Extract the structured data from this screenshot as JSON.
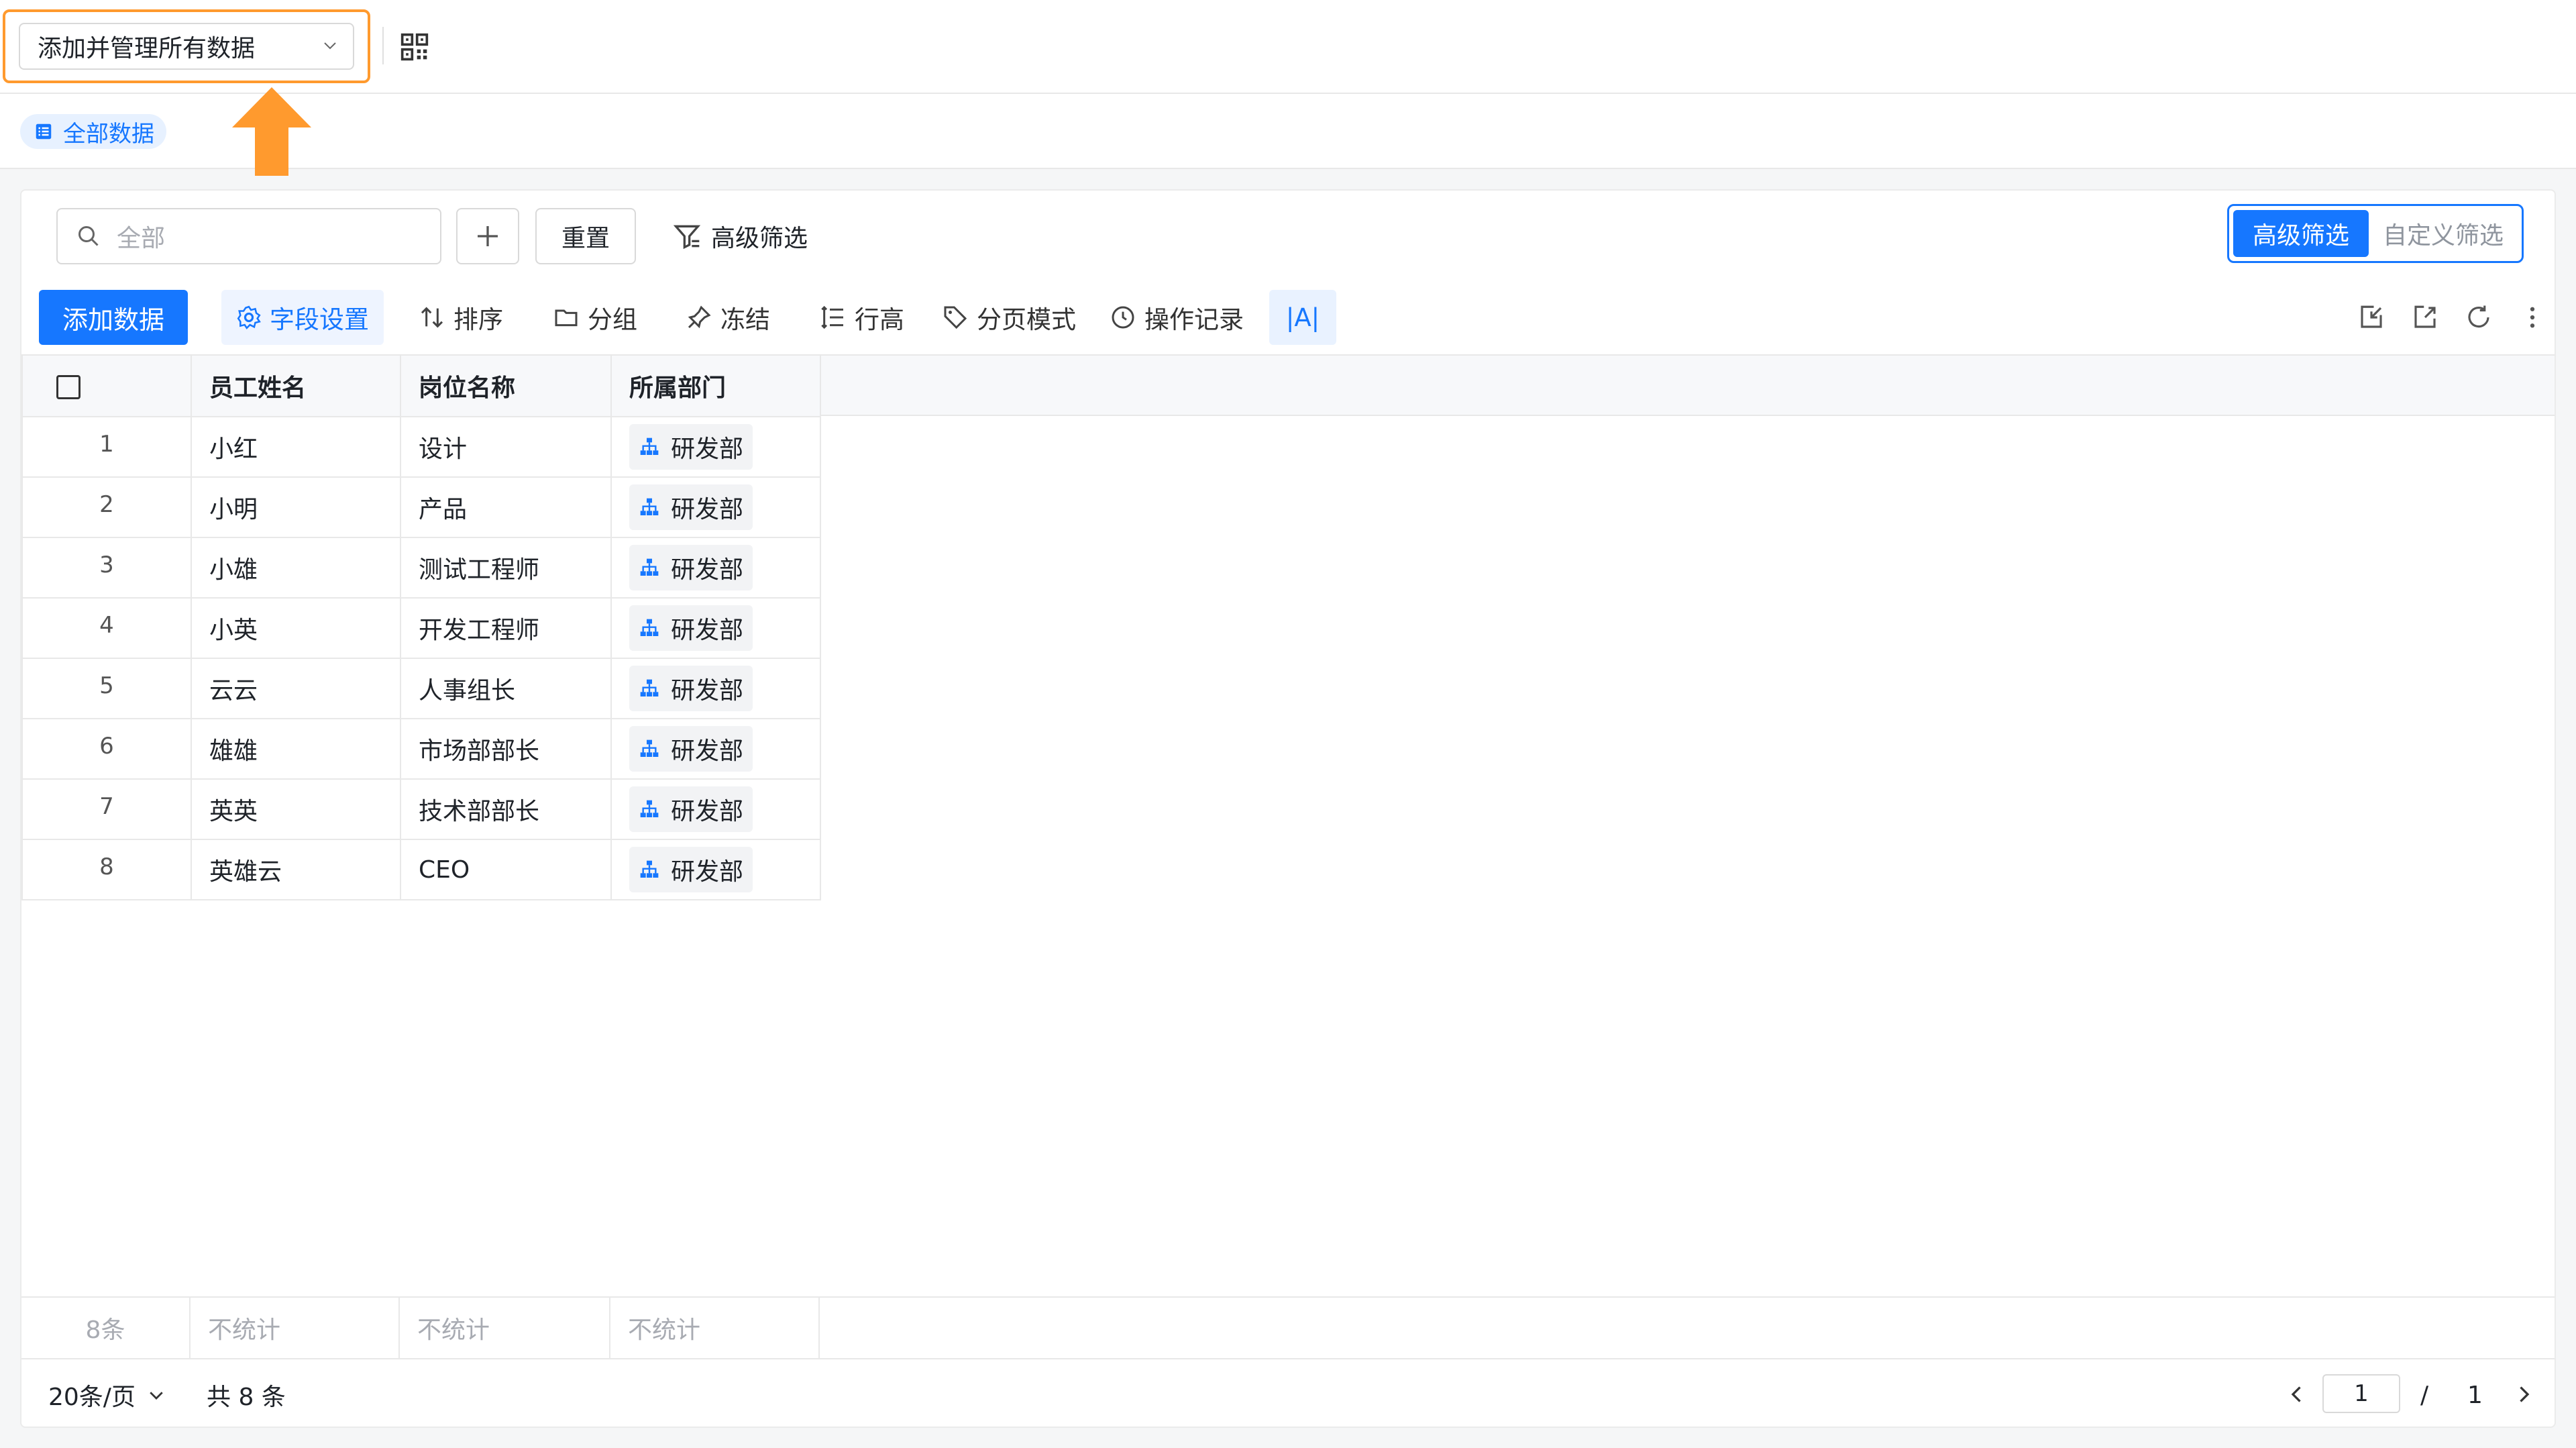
{
  "header": {
    "view_select_label": "添加并管理所有数据",
    "qr_icon": "qr-code-icon"
  },
  "tabs": [
    {
      "label": "全部数据",
      "icon": "list-icon",
      "active": true
    }
  ],
  "filter_bar": {
    "search_placeholder": "全部",
    "reset_label": "重置",
    "advanced_filter_label": "高级筛选",
    "toggle": {
      "active": "高级筛选",
      "inactive": "自定义筛选"
    }
  },
  "toolbar": {
    "add_label": "添加数据",
    "field_settings": "字段设置",
    "sort": "排序",
    "group": "分组",
    "freeze": "冻结",
    "row_height": "行高",
    "pagination_mode": "分页模式",
    "history": "操作记录",
    "text_style": "|A|"
  },
  "table": {
    "columns": [
      "员工姓名",
      "岗位名称",
      "所属部门"
    ],
    "rows": [
      {
        "index": "1",
        "name": "小红",
        "position": "设计",
        "dept": "研发部"
      },
      {
        "index": "2",
        "name": "小明",
        "position": "产品",
        "dept": "研发部"
      },
      {
        "index": "3",
        "name": "小雄",
        "position": "测试工程师",
        "dept": "研发部"
      },
      {
        "index": "4",
        "name": "小英",
        "position": "开发工程师",
        "dept": "研发部"
      },
      {
        "index": "5",
        "name": "云云",
        "position": "人事组长",
        "dept": "研发部"
      },
      {
        "index": "6",
        "name": "雄雄",
        "position": "市场部部长",
        "dept": "研发部"
      },
      {
        "index": "7",
        "name": "英英",
        "position": "技术部部长",
        "dept": "研发部"
      },
      {
        "index": "8",
        "name": "英雄云",
        "position": "CEO",
        "dept": "研发部"
      }
    ],
    "summary": {
      "count": "8条",
      "col1": "不统计",
      "col2": "不统计",
      "col3": "不统计"
    }
  },
  "pagination": {
    "page_size": "20条/页",
    "total": "共 8 条",
    "current_page": "1",
    "separator": "/",
    "total_pages": "1"
  },
  "colors": {
    "accent": "#1677ff",
    "highlight": "#ff9a2e"
  }
}
